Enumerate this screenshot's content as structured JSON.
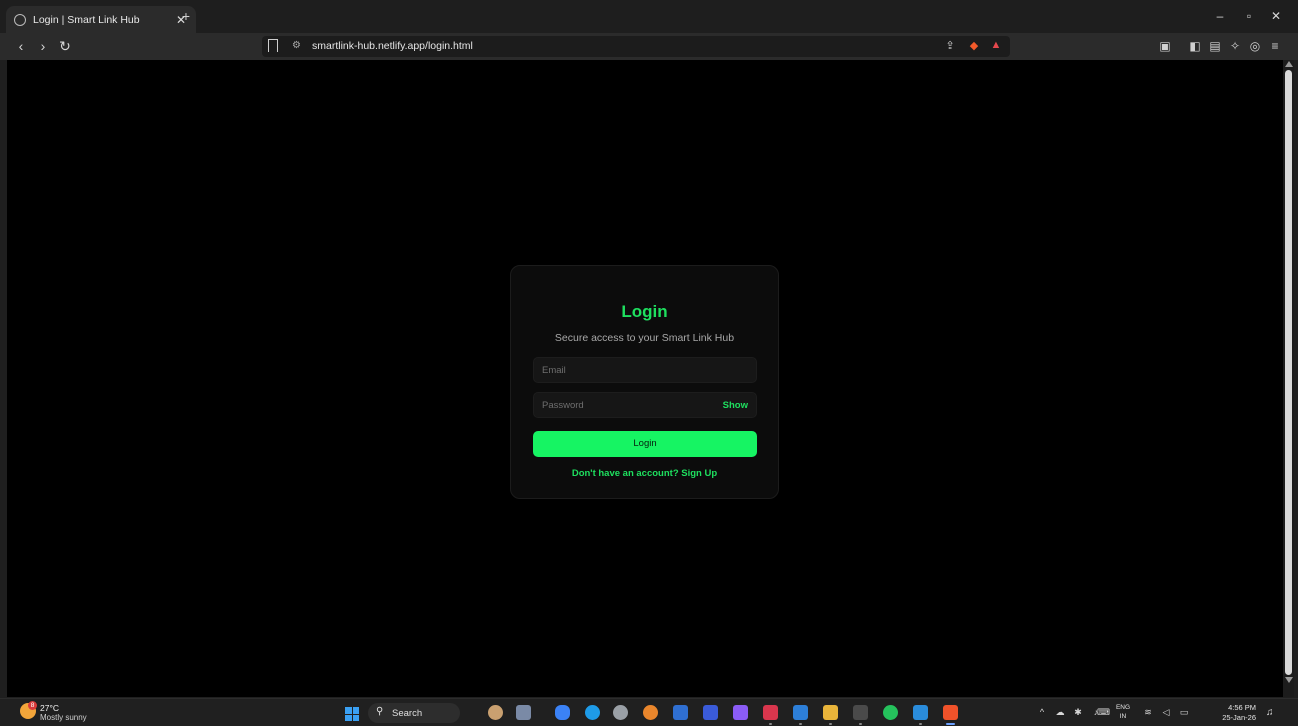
{
  "browser": {
    "tab_title": "Login | Smart Link Hub",
    "url": "smartlink-hub.netlify.app/login.html"
  },
  "login": {
    "title": "Login",
    "subtitle": "Secure access to your Smart Link Hub",
    "email_placeholder": "Email",
    "password_placeholder": "Password",
    "show_label": "Show",
    "button_label": "Login",
    "signup_text": "Don't have an account? Sign Up"
  },
  "taskbar": {
    "weather_temp": "27°C",
    "weather_desc": "Mostly sunny",
    "weather_badge": "8",
    "search_label": "Search",
    "lang_top": "ENG",
    "lang_bottom": "IN",
    "time": "4:56 PM",
    "date": "25-Jan-26"
  },
  "colors": {
    "accent": "#1ee05f",
    "button": "#16f463",
    "background": "#000000"
  }
}
